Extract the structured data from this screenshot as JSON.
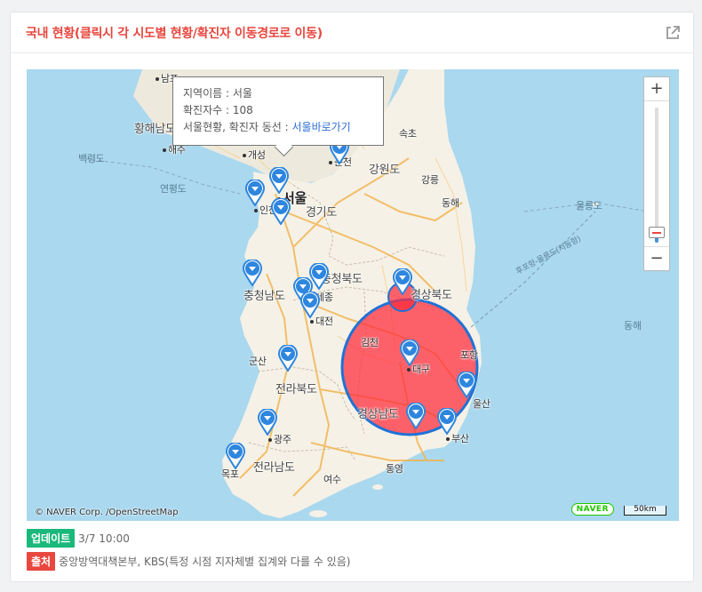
{
  "header": {
    "title": "국내 현황(클릭시 각 시도별 현황/확진자 이동경로로 이동)"
  },
  "map": {
    "labels": {
      "namp": "남포",
      "hwanghae": "황해남도",
      "haeju": "해주",
      "kaesong": "개성",
      "yellow_sea_1": "백령도",
      "yellow_sea_2": "연평도",
      "seoul": "서울",
      "incheon": "인천",
      "gyeonggi": "경기도",
      "chuncheon": "춘천",
      "gangwon": "강원도",
      "sokcho": "속초",
      "gangneung": "강릉",
      "donghae": "동해",
      "ulleungdo": "울릉도",
      "chungbuk": "충청북도",
      "chungnam": "충청남도",
      "sejong": "세종",
      "daejeon": "대전",
      "gyeongbuk": "경상북도",
      "gimcheon": "김천",
      "daegu": "대구",
      "pohang": "포항",
      "ulsan": "울산",
      "gyeongnam": "경상남도",
      "busan": "부산",
      "gunsan": "군산",
      "jeonbuk": "전라북도",
      "gwangju": "광주",
      "mokpo": "목포",
      "jeonnam": "전라남도",
      "yeosu": "여수",
      "tongyeong": "통영",
      "east_sea": "동해",
      "route": "후포항-울릉도(저동항)"
    },
    "tooltip": {
      "region_label": "지역이름 : 서울",
      "count_label": "확진자수 : 108",
      "link_prefix": "서울현황, 확진자 동선 : ",
      "link_text": "서울바로가기"
    },
    "zoom": {
      "plus": "+",
      "minus": "−",
      "level": 0.08
    },
    "copyright": "© NAVER Corp. /OpenStreetMap",
    "logo": "NAVER",
    "scale": "50km",
    "colors": {
      "sea": "#a9d8ef",
      "land": "#f3f0e7",
      "pin": "#2e86de",
      "circle": "#ff2a3a"
    }
  },
  "info": {
    "update_badge": "업데이트",
    "update_time": "3/7 10:00",
    "source_badge": "출처",
    "source_text": "중앙방역대책본부, KBS(특정 시점 지자체별 집계와 다를 수 있음)"
  }
}
